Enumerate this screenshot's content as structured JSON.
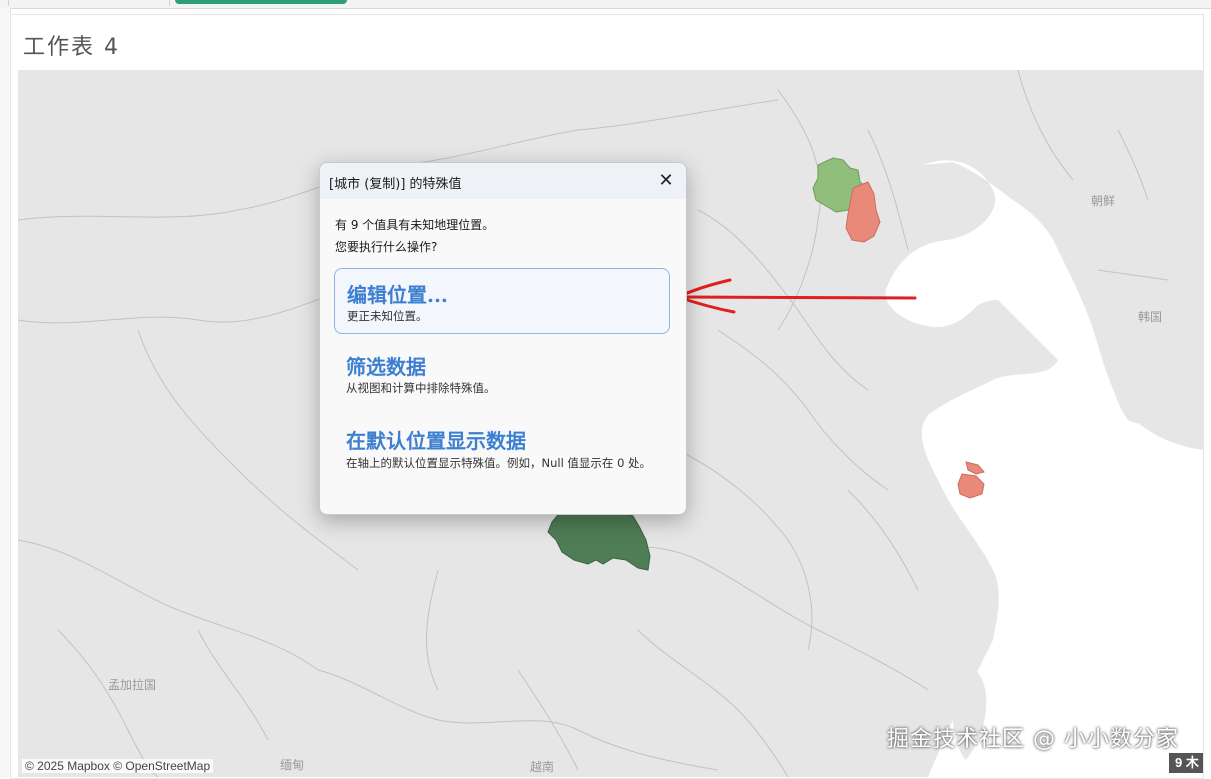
{
  "sheet": {
    "title": "工作表 4"
  },
  "map": {
    "labels": {
      "korea_north": "朝鲜",
      "korea_south": "韩国",
      "bangladesh": "孟加拉国",
      "myanmar": "缅甸",
      "vietnam": "越南"
    },
    "attribution": "© 2025 Mapbox © OpenStreetMap",
    "colors": {
      "land": "#e6e6e6",
      "sea": "#ffffff",
      "border": "#bdbdbd",
      "green_light": "#8fbf7a",
      "green_dark": "#4f7d55",
      "red": "#e8897a",
      "arrow": "#e02020"
    }
  },
  "dialog": {
    "title": "[城市 (复制)] 的特殊值",
    "close_icon": "close-icon",
    "message_line1": "有 9 个值具有未知地理位置。",
    "message_line2": "您要执行什么操作?",
    "options": [
      {
        "title": "编辑位置...",
        "desc": "更正未知位置。"
      },
      {
        "title": "筛选数据",
        "desc": "从视图和计算中排除特殊值。"
      },
      {
        "title": "在默认位置显示数据",
        "desc": "在轴上的默认位置显示特殊值。例如，Null 值显示在 0 处。"
      }
    ]
  },
  "watermark": "掘金技术社区 @ 小小数分家",
  "page_badge": "9 木"
}
